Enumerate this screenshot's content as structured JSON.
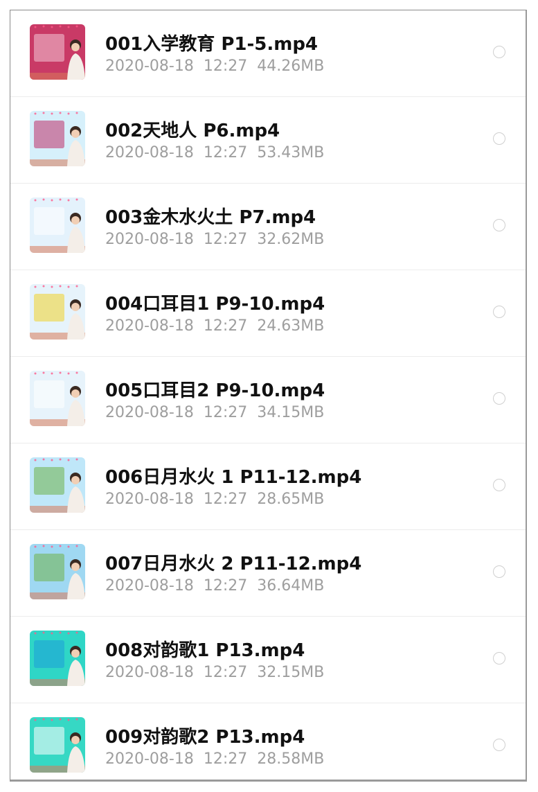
{
  "files": [
    {
      "name": "001入学教育 P1-5.mp4",
      "date": "2020-08-18",
      "time": "12:27",
      "size": "44.26MB",
      "thumb": {
        "bg": "#c93a66",
        "accent": "#f2c6d5"
      }
    },
    {
      "name": "002天地人 P6.mp4",
      "date": "2020-08-18",
      "time": "12:27",
      "size": "53.43MB",
      "thumb": {
        "bg": "#d6f0fb",
        "accent": "#c0306a"
      }
    },
    {
      "name": "003金木水火土 P7.mp4",
      "date": "2020-08-18",
      "time": "12:27",
      "size": "32.62MB",
      "thumb": {
        "bg": "#e4f2fc",
        "accent": "#ffffff"
      }
    },
    {
      "name": "004口耳目1 P9-10.mp4",
      "date": "2020-08-18",
      "time": "12:27",
      "size": "24.63MB",
      "thumb": {
        "bg": "#e6f3fb",
        "accent": "#f1d22a"
      }
    },
    {
      "name": "005口耳目2 P9-10.mp4",
      "date": "2020-08-18",
      "time": "12:27",
      "size": "34.15MB",
      "thumb": {
        "bg": "#e7f3fb",
        "accent": "#ffffff"
      }
    },
    {
      "name": "006日月水火 1 P11-12.mp4",
      "date": "2020-08-18",
      "time": "12:27",
      "size": "28.65MB",
      "thumb": {
        "bg": "#bfe7f9",
        "accent": "#6fb24a"
      }
    },
    {
      "name": "007日月水火 2 P11-12.mp4",
      "date": "2020-08-18",
      "time": "12:27",
      "size": "36.64MB",
      "thumb": {
        "bg": "#9fd8f2",
        "accent": "#6fb24a"
      }
    },
    {
      "name": "008对韵歌1 P13.mp4",
      "date": "2020-08-18",
      "time": "12:27",
      "size": "32.15MB",
      "thumb": {
        "bg": "#2fd6c6",
        "accent": "#1e9fd8"
      }
    },
    {
      "name": "009对韵歌2 P13.mp4",
      "date": "2020-08-18",
      "time": "12:27",
      "size": "28.58MB",
      "thumb": {
        "bg": "#36d8c4",
        "accent": "#ffffff"
      }
    }
  ],
  "colors": {
    "title": "#111111",
    "meta": "#9e9e9e",
    "divider": "#ececec",
    "radio": "#cfcfcf"
  }
}
